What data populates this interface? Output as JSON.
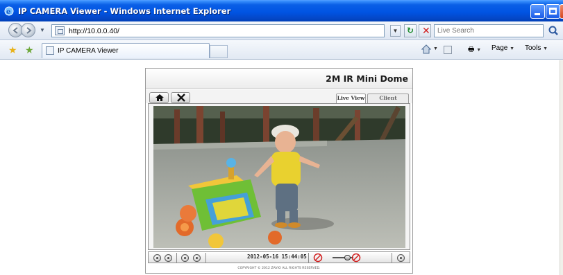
{
  "window": {
    "title": "IP CAMERA Viewer - Windows Internet Explorer"
  },
  "address_bar": {
    "url": "http://10.0.0.40/",
    "search_placeholder": "Live Search"
  },
  "tabs": [
    {
      "label": "IP CAMERA Viewer"
    }
  ],
  "command_bar": {
    "page_label": "Page",
    "tools_label": "Tools"
  },
  "camera": {
    "model_name": "2M IR Mini Dome",
    "view_tabs": {
      "live_view": "Live View",
      "client_setting": "Client Setting"
    },
    "timestamp": "2012-05-16 15:44:05",
    "copyright": "COPYRIGHT © 2012 ZAVIO ALL RIGHTS RESERVED."
  },
  "icons": {
    "home": "home-icon",
    "settings": "tools-icon"
  },
  "colors": {
    "title_bar": "#0054e3",
    "panel_border": "#9a9a9a",
    "stop_red": "#d11f1f"
  }
}
